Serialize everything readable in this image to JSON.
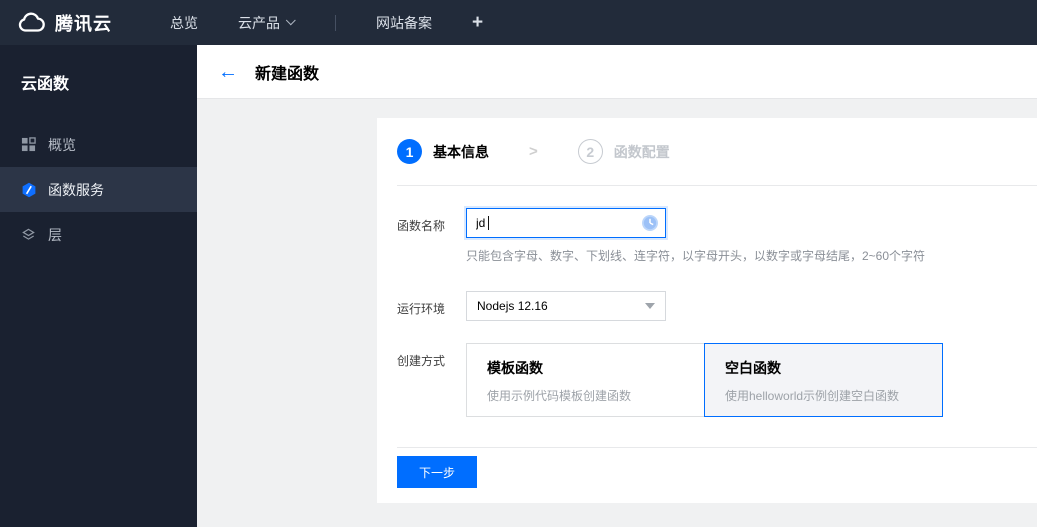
{
  "topnav": {
    "brand": "腾讯云",
    "overview": "总览",
    "products": "云产品",
    "beian": "网站备案",
    "plus": "+"
  },
  "sidebar": {
    "title": "云函数",
    "items": [
      {
        "label": "概览",
        "icon": "grid-icon",
        "active": false
      },
      {
        "label": "函数服务",
        "icon": "scf-hexagon-icon",
        "active": true
      },
      {
        "label": "层",
        "icon": "layers-icon",
        "active": false
      }
    ]
  },
  "header": {
    "back_icon": "←",
    "title": "新建函数"
  },
  "wizard": {
    "separator": ">",
    "steps": [
      {
        "number": "1",
        "label": "基本信息",
        "state": "active"
      },
      {
        "number": "2",
        "label": "函数配置",
        "state": "pending"
      }
    ]
  },
  "form": {
    "name_field": {
      "label": "函数名称",
      "value": "jd",
      "status_icon": "clock-icon",
      "help": "只能包含字母、数字、下划线、连字符，以字母开头，以数字或字母结尾，2~60个字符"
    },
    "runtime_field": {
      "label": "运行环境",
      "value": "Nodejs 12.16"
    },
    "method_field": {
      "label": "创建方式",
      "options": [
        {
          "title": "模板函数",
          "desc": "使用示例代码模板创建函数",
          "selected": false
        },
        {
          "title": "空白函数",
          "desc": "使用helloworld示例创建空白函数",
          "selected": true
        }
      ]
    }
  },
  "footer": {
    "next_label": "下一步"
  },
  "colors": {
    "accent": "#006eff",
    "topbar_bg": "#222b3a",
    "sidebar_bg": "#1a2130",
    "sidebar_active_bg": "#2c3547",
    "content_bg": "#f0f1f2"
  }
}
